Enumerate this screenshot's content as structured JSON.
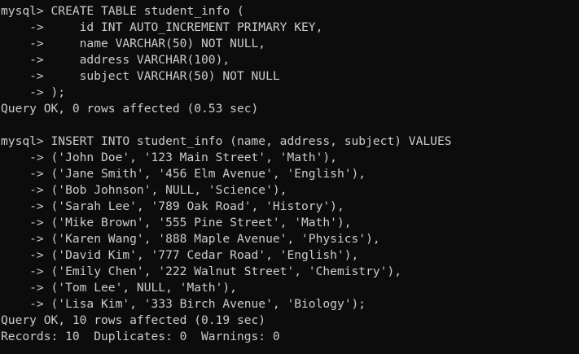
{
  "colors": {
    "background": "#0c0c0c",
    "text": "#cccccc"
  },
  "terminal": {
    "lines": [
      "mysql> CREATE TABLE student_info (",
      "    ->     id INT AUTO_INCREMENT PRIMARY KEY,",
      "    ->     name VARCHAR(50) NOT NULL,",
      "    ->     address VARCHAR(100),",
      "    ->     subject VARCHAR(50) NOT NULL",
      "    -> );",
      "Query OK, 0 rows affected (0.53 sec)",
      "",
      "mysql> INSERT INTO student_info (name, address, subject) VALUES",
      "    -> ('John Doe', '123 Main Street', 'Math'),",
      "    -> ('Jane Smith', '456 Elm Avenue', 'English'),",
      "    -> ('Bob Johnson', NULL, 'Science'),",
      "    -> ('Sarah Lee', '789 Oak Road', 'History'),",
      "    -> ('Mike Brown', '555 Pine Street', 'Math'),",
      "    -> ('Karen Wang', '888 Maple Avenue', 'Physics'),",
      "    -> ('David Kim', '777 Cedar Road', 'English'),",
      "    -> ('Emily Chen', '222 Walnut Street', 'Chemistry'),",
      "    -> ('Tom Lee', NULL, 'Math'),",
      "    -> ('Lisa Kim', '333 Birch Avenue', 'Biology');",
      "Query OK, 10 rows affected (0.19 sec)",
      "Records: 10  Duplicates: 0  Warnings: 0"
    ]
  }
}
